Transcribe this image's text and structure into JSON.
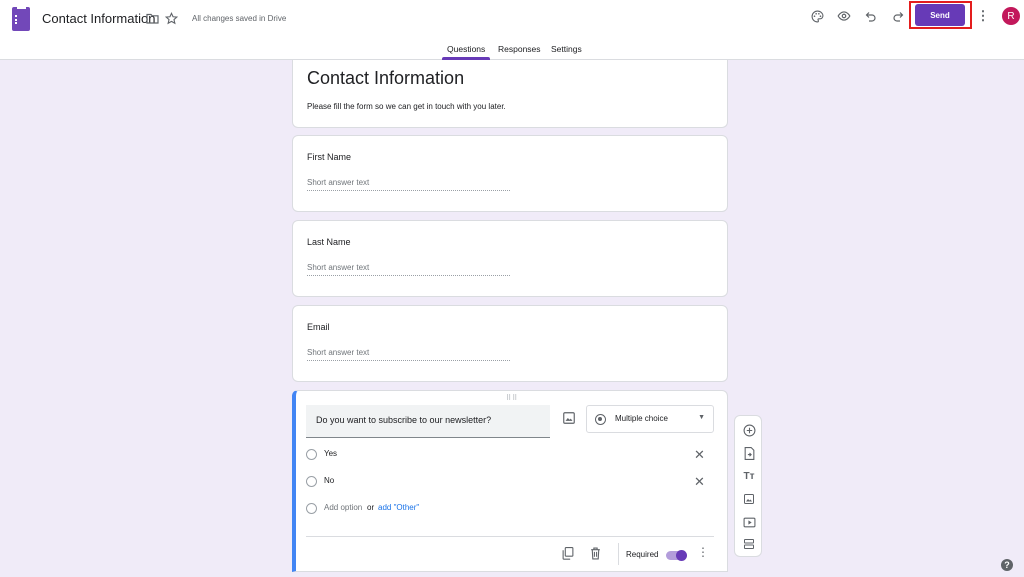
{
  "header": {
    "doc_title": "Contact Information",
    "saved_status": "All changes saved in Drive",
    "send_label": "Send",
    "avatar_initial": "R"
  },
  "tabs": [
    {
      "label": "Questions",
      "active": true
    },
    {
      "label": "Responses",
      "active": false
    },
    {
      "label": "Settings",
      "active": false
    }
  ],
  "form": {
    "title": "Contact Information",
    "description": "Please fill the form so we can get in touch with you later."
  },
  "questions": [
    {
      "title": "First Name",
      "placeholder": "Short answer text"
    },
    {
      "title": "Last Name",
      "placeholder": "Short answer text"
    },
    {
      "title": "Email",
      "placeholder": "Short answer text"
    }
  ],
  "active_question": {
    "title": "Do you want to subscribe to our newsletter?",
    "type": "Multiple choice",
    "options": [
      "Yes",
      "No"
    ],
    "add_option": "Add option",
    "or": "or",
    "add_other": "add \"Other\"",
    "required_label": "Required",
    "required": true
  },
  "colors": {
    "accent": "#673ab7",
    "background": "#f0ebf8",
    "active_border": "#4285f4",
    "highlight": "#e41d1d"
  },
  "icons": {
    "header": [
      "forms-logo-icon",
      "folder-icon",
      "star-icon",
      "palette-icon",
      "eye-icon",
      "undo-icon",
      "redo-icon",
      "more-vert-icon"
    ],
    "toolbar": [
      "add-question-icon",
      "import-questions-icon",
      "add-title-icon",
      "add-image-icon",
      "add-video-icon",
      "add-section-icon"
    ]
  }
}
